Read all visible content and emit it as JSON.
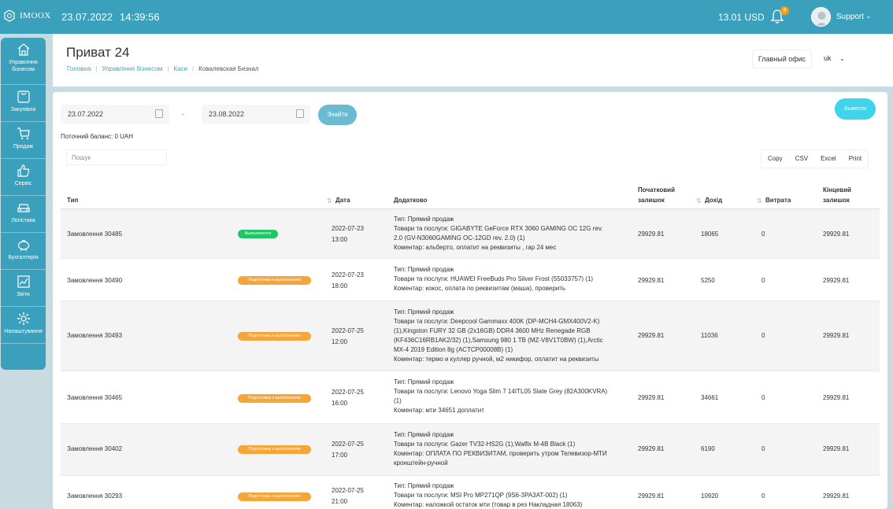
{
  "topbar": {
    "logo_text": "IMOOX",
    "date": "23.07.2022",
    "time": "14:39:56",
    "balance": "13.01 USD",
    "notifications_count": "9",
    "user_name": "Support"
  },
  "sidebar": {
    "items": [
      {
        "label": "Управління бізнесом",
        "icon": "home-icon"
      },
      {
        "label": "Закупівля",
        "icon": "clipboard-icon"
      },
      {
        "label": "Продаж",
        "icon": "cart-icon"
      },
      {
        "label": "Сервіс",
        "icon": "thumbs-up-icon"
      },
      {
        "label": "Логістика",
        "icon": "car-icon"
      },
      {
        "label": "Бухгалтерія",
        "icon": "piggy-bank-icon"
      },
      {
        "label": "Звіти",
        "icon": "chart-icon"
      },
      {
        "label": "Налаштування",
        "icon": "gear-icon"
      }
    ]
  },
  "header": {
    "title": "Приват 24",
    "breadcrumbs": [
      "Головна",
      "Управління бізнесом",
      "Каси",
      "Ковалевская Безнал"
    ],
    "office": "Главный офис",
    "language": "uk"
  },
  "filters": {
    "date_from": "23.07.2022",
    "date_to": "23.08.2022",
    "dash": "-",
    "find_label": "Знайти",
    "print_label": "Вывести",
    "balance_text": "Поточний баланс: 0 UAH",
    "search_placeholder": "Пошук",
    "exports": [
      "Copy",
      "CSV",
      "Excel",
      "Print"
    ]
  },
  "table": {
    "headers": {
      "type": "Тип",
      "date": "Дата",
      "details": "Додатково",
      "start_balance_1": "Початковий",
      "start_balance_2": "залишок",
      "income": "Дохід",
      "expense": "Витрата",
      "end_balance_1": "Кінцевий",
      "end_balance_2": "залишок"
    },
    "rows": [
      {
        "type": "Замовлення 30485",
        "status": "Выполняется",
        "date": "2022-07-23",
        "time": "13:00",
        "details": [
          "Тип: Прямий продаж",
          "Товари та послуги: GIGABYTE GeForce RTX 3060 GAMING OC 12G rev.",
          "2.0 (GV-N3060GAMING OC-12GD rev. 2.0) (1)",
          "Коментар: альберто, оплатит на реквизиты , гар 24 мес"
        ],
        "start": "29929.81",
        "income": "18065",
        "expense": "0",
        "end": "29929.81"
      },
      {
        "type": "Замовлення 30490",
        "status": "Подготовка к выполнению",
        "date": "2022-07-23",
        "time": "18:00",
        "details": [
          "Тип: Прямий продаж",
          "Товари та послуги: HUAWEI FreeBuds Pro Silver Frost (55033757) (1)",
          "Коментар: кокос, оплата по реквизитам (маша), проверить"
        ],
        "start": "29929.81",
        "income": "5250",
        "expense": "0",
        "end": "29929.81"
      },
      {
        "type": "Замовлення 30493",
        "status": "Подготовка к выполнению",
        "date": "2022-07-25",
        "time": "12:00",
        "details": [
          "Тип: Прямий продаж",
          "Товари та послуги: Deepcool Gammaxx 400K (DP-MCH4-GMX400V2-K)",
          "(1),Kingston FURY 32 GB (2x16GB) DDR4 3600 MHz Renegade RGB",
          "(KF436C16RB1AK2/32) (1),Samsung 980 1 TB (MZ-V8V1T0BW) (1),Arctic",
          "MX-4 2019 Edition 8g (ACTCP00008B) (1)",
          "Коментар: термо и куллер ручной, м2 никифор, оплатит на реквизиты"
        ],
        "start": "29929.81",
        "income": "11036",
        "expense": "0",
        "end": "29929.81"
      },
      {
        "type": "Замовлення 30465",
        "status": "Подготовка к выполнению",
        "date": "2022-07-25",
        "time": "16:00",
        "details": [
          "Тип: Прямий продаж",
          "Товари та послуги: Lenovo Yoga Slim 7 14ITL05 Slate Grey (82A300KVRA)",
          "(1)",
          "Коментар: мти 34651 доплатит"
        ],
        "start": "29929.81",
        "income": "34661",
        "expense": "0",
        "end": "29929.81"
      },
      {
        "type": "Замовлення 30402",
        "status": "Подготовка к выполнению",
        "date": "2022-07-25",
        "time": "17:00",
        "details": [
          "Тип: Прямий продаж",
          "Товари та послуги: Gazer TV32-HS2G (1),Walfix M-4B Black (1)",
          "Коментар: ОПЛАТА ПО РЕКВИЗИТАМ, проверить утром Телевизор-МТИ",
          "кронштейн-ручной"
        ],
        "start": "29929.81",
        "income": "6190",
        "expense": "0",
        "end": "29929.81"
      },
      {
        "type": "Замовлення 30293",
        "status": "Подготовка к выполнению",
        "date": "2022-07-25",
        "time": "21:00",
        "details": [
          "Тип: Прямий продаж",
          "Товари та послуги: MSI Pro MP271QP (9S6-3PA3AT-002) (1)",
          "Коментар: наложкой остаток мти (товар в рез Накладная 18063)"
        ],
        "start": "29929.81",
        "income": "10920",
        "expense": "0",
        "end": "29929.81"
      }
    ]
  },
  "colors": {
    "accent": "#3ba0bb",
    "status_green": "#23c466",
    "status_orange": "#f6a53b",
    "print_button": "#3fd3ec"
  }
}
